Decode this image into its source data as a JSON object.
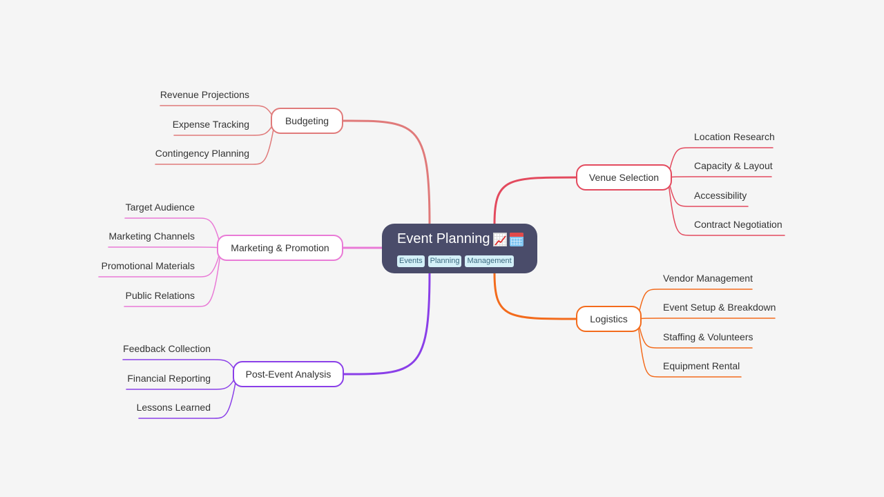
{
  "root": {
    "title": "Event Planning",
    "emoji_icons": [
      "chart-increasing-icon",
      "calendar-icon"
    ],
    "tags": [
      "Events",
      "Planning",
      "Management"
    ]
  },
  "branches": [
    {
      "id": "budgeting",
      "label": "Budgeting",
      "side": "left",
      "color": "#e07a7a",
      "children": [
        "Revenue Projections",
        "Expense Tracking",
        "Contingency Planning"
      ]
    },
    {
      "id": "marketing",
      "label": "Marketing & Promotion",
      "side": "left",
      "color": "#e97ad6",
      "children": [
        "Target Audience",
        "Marketing Channels",
        "Promotional Materials",
        "Public Relations"
      ]
    },
    {
      "id": "post-event",
      "label": "Post-Event Analysis",
      "side": "left",
      "color": "#8a3fe8",
      "children": [
        "Feedback Collection",
        "Financial Reporting",
        "Lessons Learned"
      ]
    },
    {
      "id": "venue",
      "label": "Venue Selection",
      "side": "right",
      "color": "#e34a5e",
      "children": [
        "Location Research",
        "Capacity & Layout",
        "Accessibility",
        "Contract Negotiation"
      ]
    },
    {
      "id": "logistics",
      "label": "Logistics",
      "side": "right",
      "color": "#f36b1c",
      "children": [
        "Vendor Management",
        "Event Setup & Breakdown",
        "Staffing & Volunteers",
        "Equipment Rental"
      ]
    }
  ]
}
